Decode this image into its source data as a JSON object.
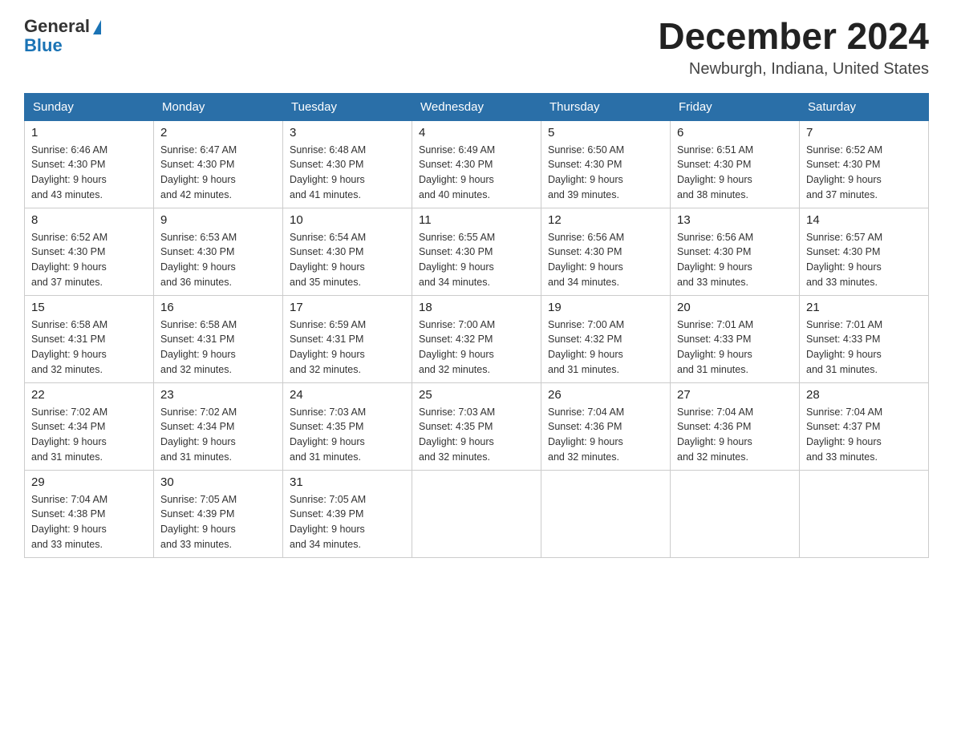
{
  "logo": {
    "general": "General",
    "blue": "Blue"
  },
  "header": {
    "title": "December 2024",
    "subtitle": "Newburgh, Indiana, United States"
  },
  "days_of_week": [
    "Sunday",
    "Monday",
    "Tuesday",
    "Wednesday",
    "Thursday",
    "Friday",
    "Saturday"
  ],
  "weeks": [
    [
      {
        "day": "1",
        "sunrise": "6:46 AM",
        "sunset": "4:30 PM",
        "daylight": "9 hours and 43 minutes."
      },
      {
        "day": "2",
        "sunrise": "6:47 AM",
        "sunset": "4:30 PM",
        "daylight": "9 hours and 42 minutes."
      },
      {
        "day": "3",
        "sunrise": "6:48 AM",
        "sunset": "4:30 PM",
        "daylight": "9 hours and 41 minutes."
      },
      {
        "day": "4",
        "sunrise": "6:49 AM",
        "sunset": "4:30 PM",
        "daylight": "9 hours and 40 minutes."
      },
      {
        "day": "5",
        "sunrise": "6:50 AM",
        "sunset": "4:30 PM",
        "daylight": "9 hours and 39 minutes."
      },
      {
        "day": "6",
        "sunrise": "6:51 AM",
        "sunset": "4:30 PM",
        "daylight": "9 hours and 38 minutes."
      },
      {
        "day": "7",
        "sunrise": "6:52 AM",
        "sunset": "4:30 PM",
        "daylight": "9 hours and 37 minutes."
      }
    ],
    [
      {
        "day": "8",
        "sunrise": "6:52 AM",
        "sunset": "4:30 PM",
        "daylight": "9 hours and 37 minutes."
      },
      {
        "day": "9",
        "sunrise": "6:53 AM",
        "sunset": "4:30 PM",
        "daylight": "9 hours and 36 minutes."
      },
      {
        "day": "10",
        "sunrise": "6:54 AM",
        "sunset": "4:30 PM",
        "daylight": "9 hours and 35 minutes."
      },
      {
        "day": "11",
        "sunrise": "6:55 AM",
        "sunset": "4:30 PM",
        "daylight": "9 hours and 34 minutes."
      },
      {
        "day": "12",
        "sunrise": "6:56 AM",
        "sunset": "4:30 PM",
        "daylight": "9 hours and 34 minutes."
      },
      {
        "day": "13",
        "sunrise": "6:56 AM",
        "sunset": "4:30 PM",
        "daylight": "9 hours and 33 minutes."
      },
      {
        "day": "14",
        "sunrise": "6:57 AM",
        "sunset": "4:30 PM",
        "daylight": "9 hours and 33 minutes."
      }
    ],
    [
      {
        "day": "15",
        "sunrise": "6:58 AM",
        "sunset": "4:31 PM",
        "daylight": "9 hours and 32 minutes."
      },
      {
        "day": "16",
        "sunrise": "6:58 AM",
        "sunset": "4:31 PM",
        "daylight": "9 hours and 32 minutes."
      },
      {
        "day": "17",
        "sunrise": "6:59 AM",
        "sunset": "4:31 PM",
        "daylight": "9 hours and 32 minutes."
      },
      {
        "day": "18",
        "sunrise": "7:00 AM",
        "sunset": "4:32 PM",
        "daylight": "9 hours and 32 minutes."
      },
      {
        "day": "19",
        "sunrise": "7:00 AM",
        "sunset": "4:32 PM",
        "daylight": "9 hours and 31 minutes."
      },
      {
        "day": "20",
        "sunrise": "7:01 AM",
        "sunset": "4:33 PM",
        "daylight": "9 hours and 31 minutes."
      },
      {
        "day": "21",
        "sunrise": "7:01 AM",
        "sunset": "4:33 PM",
        "daylight": "9 hours and 31 minutes."
      }
    ],
    [
      {
        "day": "22",
        "sunrise": "7:02 AM",
        "sunset": "4:34 PM",
        "daylight": "9 hours and 31 minutes."
      },
      {
        "day": "23",
        "sunrise": "7:02 AM",
        "sunset": "4:34 PM",
        "daylight": "9 hours and 31 minutes."
      },
      {
        "day": "24",
        "sunrise": "7:03 AM",
        "sunset": "4:35 PM",
        "daylight": "9 hours and 31 minutes."
      },
      {
        "day": "25",
        "sunrise": "7:03 AM",
        "sunset": "4:35 PM",
        "daylight": "9 hours and 32 minutes."
      },
      {
        "day": "26",
        "sunrise": "7:04 AM",
        "sunset": "4:36 PM",
        "daylight": "9 hours and 32 minutes."
      },
      {
        "day": "27",
        "sunrise": "7:04 AM",
        "sunset": "4:36 PM",
        "daylight": "9 hours and 32 minutes."
      },
      {
        "day": "28",
        "sunrise": "7:04 AM",
        "sunset": "4:37 PM",
        "daylight": "9 hours and 33 minutes."
      }
    ],
    [
      {
        "day": "29",
        "sunrise": "7:04 AM",
        "sunset": "4:38 PM",
        "daylight": "9 hours and 33 minutes."
      },
      {
        "day": "30",
        "sunrise": "7:05 AM",
        "sunset": "4:39 PM",
        "daylight": "9 hours and 33 minutes."
      },
      {
        "day": "31",
        "sunrise": "7:05 AM",
        "sunset": "4:39 PM",
        "daylight": "9 hours and 34 minutes."
      },
      null,
      null,
      null,
      null
    ]
  ],
  "labels": {
    "sunrise_prefix": "Sunrise: ",
    "sunset_prefix": "Sunset: ",
    "daylight_prefix": "Daylight: "
  },
  "colors": {
    "header_bg": "#2a6fa8",
    "header_text": "#ffffff",
    "border": "#aaaaaa",
    "title": "#222222"
  }
}
